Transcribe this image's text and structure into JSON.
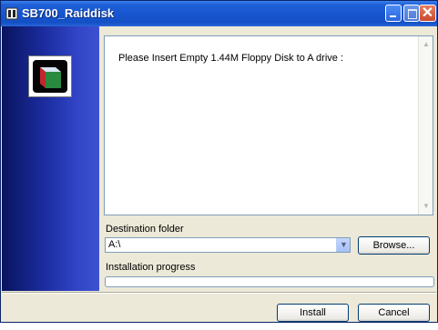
{
  "window": {
    "title": "SB700_Raiddisk"
  },
  "content": {
    "message": "Please Insert Empty 1.44M Floppy Disk to A drive :"
  },
  "destination": {
    "label": "Destination folder",
    "value": "A:\\"
  },
  "browse_label": "Browse...",
  "progress": {
    "label": "Installation progress",
    "value": 0
  },
  "buttons": {
    "install": "Install",
    "cancel": "Cancel"
  },
  "icons": {
    "title": "installer-icon",
    "logo": "cube-icon",
    "minimize": "minimize-icon",
    "maximize": "maximize-icon",
    "close": "close-icon",
    "combo": "chevron-down-icon"
  },
  "colors": {
    "titlebar": "#1756d0",
    "sidebar": "#1a2a9a",
    "dialog_bg": "#ece9d8"
  }
}
